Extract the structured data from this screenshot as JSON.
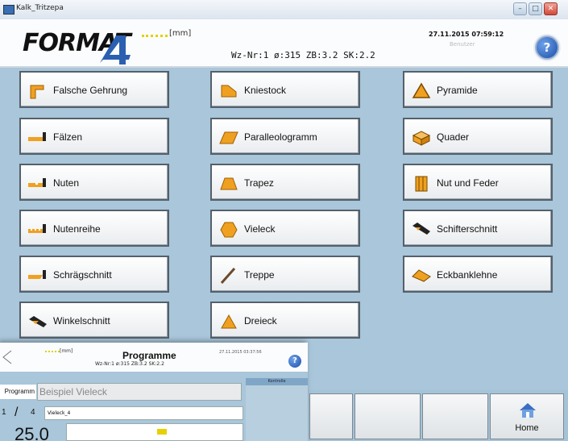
{
  "window": {
    "title": "Kalk_Tritzepa"
  },
  "header": {
    "unit": "[mm]",
    "tool_info": "Wz-Nr:1  ø:315  ZB:3.2  SK:2.2",
    "datetime": "27.11.2015 07:59:12",
    "user": "Benutzer",
    "help": "?"
  },
  "buttons": {
    "col1": [
      {
        "label": "Falsche Gehrung",
        "icon": "miter-icon"
      },
      {
        "label": "Fälzen",
        "icon": "rebate-icon"
      },
      {
        "label": "Nuten",
        "icon": "groove-icon"
      },
      {
        "label": "Nutenreihe",
        "icon": "groove-row-icon"
      },
      {
        "label": "Schrägschnitt",
        "icon": "bevel-cut-icon"
      },
      {
        "label": "Winkelschnitt",
        "icon": "angle-cut-icon"
      }
    ],
    "col2": [
      {
        "label": "Kniestock",
        "icon": "knee-wall-icon"
      },
      {
        "label": "Paralleologramm",
        "icon": "parallelogram-icon"
      },
      {
        "label": "Trapez",
        "icon": "trapezoid-icon"
      },
      {
        "label": "Vieleck",
        "icon": "polygon-icon"
      },
      {
        "label": "Treppe",
        "icon": "stair-icon"
      },
      {
        "label": "Dreieck",
        "icon": "triangle-icon"
      }
    ],
    "col3": [
      {
        "label": "Pyramide",
        "icon": "pyramid-icon"
      },
      {
        "label": "Quader",
        "icon": "cuboid-icon"
      },
      {
        "label": "Nut und Feder",
        "icon": "tongue-groove-icon"
      },
      {
        "label": "Schifterschnitt",
        "icon": "compound-cut-icon"
      },
      {
        "label": "Eckbanklehne",
        "icon": "bench-back-icon"
      }
    ]
  },
  "taskbar": {
    "home_label": "Home"
  },
  "inset": {
    "unit": "[mm]",
    "title": "Programme",
    "tool_info": "Wz-Nr:1  ø:315  ZB:3.2  SK:2.2",
    "datetime": "27.11.2015 03:37:56",
    "programme_label": "Programm",
    "programme_value": "Beispiel Vieleck",
    "side_header": "Kontrolle",
    "count_current": "1",
    "count_sep": "/",
    "count_total": "4",
    "item_name": "Vieleck_4",
    "big_value": "25.0"
  },
  "colors": {
    "accent_orange": "#f0a020",
    "background": "#a9c6da"
  }
}
